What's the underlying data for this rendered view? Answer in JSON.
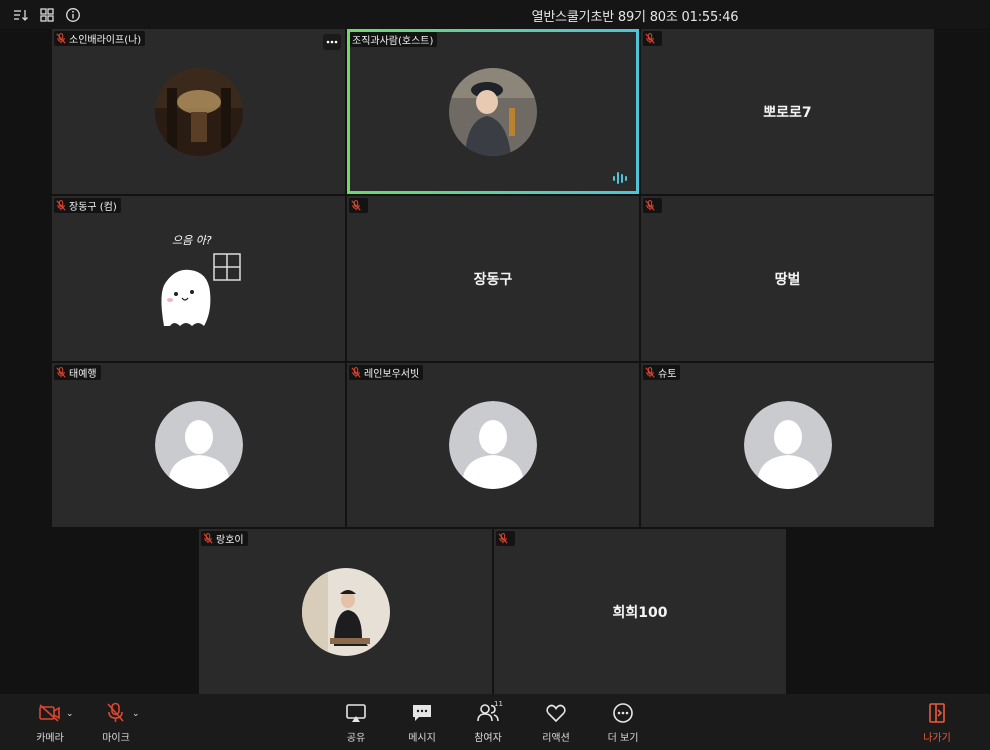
{
  "meeting": {
    "title": "열반스쿨기초반 89기 80조 01:55:46"
  },
  "topbar": {
    "icons": [
      "sort-icon",
      "grid-view-icon",
      "info-icon"
    ]
  },
  "participants": [
    {
      "name": "소인배라이프(나)",
      "muted": true,
      "display": "photo"
    },
    {
      "name": "조직과사람(호스트)",
      "muted": false,
      "display": "photo",
      "speaking": true
    },
    {
      "name": "",
      "muted": true,
      "display": "name",
      "big_name": "뽀로로7"
    },
    {
      "name": "장동구 (컴)",
      "muted": true,
      "display": "sticker",
      "sticker_text": "으음 아?"
    },
    {
      "name": "",
      "muted": true,
      "display": "name",
      "big_name": "장동구"
    },
    {
      "name": "",
      "muted": true,
      "display": "name",
      "big_name": "땅벌"
    },
    {
      "name": "태예행",
      "muted": true,
      "display": "default-avatar"
    },
    {
      "name": "레인보우서빗",
      "muted": true,
      "display": "default-avatar"
    },
    {
      "name": "슈토",
      "muted": true,
      "display": "default-avatar"
    },
    {
      "name": "랑호이",
      "muted": true,
      "display": "photo"
    },
    {
      "name": "",
      "muted": true,
      "display": "name",
      "big_name": "희희100"
    }
  ],
  "toolbar": {
    "camera": "카메라",
    "mic": "마이크",
    "share": "공유",
    "message": "메시지",
    "participants": "참여자",
    "participants_count": "11",
    "reaction": "리액션",
    "more": "더 보기",
    "leave": "나가기"
  },
  "colors": {
    "mute": "#e0452f",
    "leave": "#ef5a3a",
    "active_border_start": "#6fd96a",
    "active_border_end": "#4fc3d8",
    "tile": "#2a2a2a"
  }
}
